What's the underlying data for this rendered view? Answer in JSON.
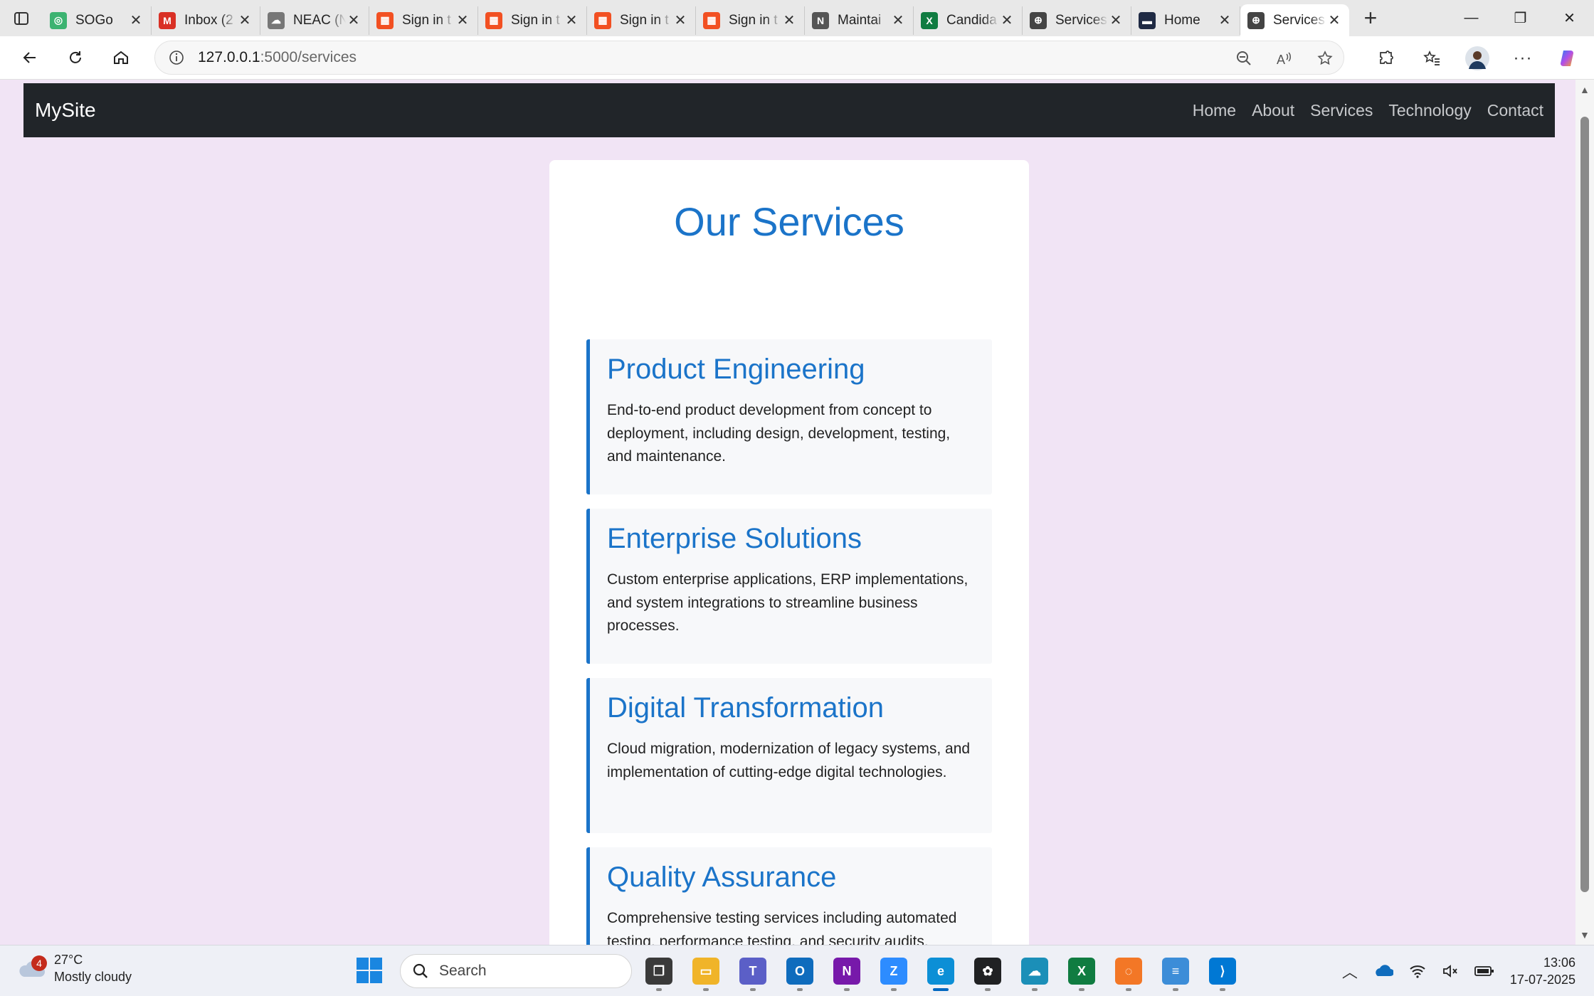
{
  "browser": {
    "tabs": [
      {
        "title": "SOGo",
        "icon": "sogo-icon",
        "color": "#3cb371",
        "glyph": "◎"
      },
      {
        "title": "Inbox (2",
        "icon": "gmail-icon",
        "color": "#d93025",
        "glyph": "M"
      },
      {
        "title": "NEAC (N",
        "icon": "neac-icon",
        "color": "#777777",
        "glyph": "☁"
      },
      {
        "title": "Sign in t",
        "icon": "microsoft-icon",
        "color": "#f25022",
        "glyph": "▦"
      },
      {
        "title": "Sign in t",
        "icon": "microsoft-icon",
        "color": "#f25022",
        "glyph": "▦"
      },
      {
        "title": "Sign in t",
        "icon": "microsoft-icon",
        "color": "#f25022",
        "glyph": "▦"
      },
      {
        "title": "Sign in t",
        "icon": "microsoft-icon",
        "color": "#f25022",
        "glyph": "▦"
      },
      {
        "title": "Maintai",
        "icon": "notion-icon",
        "color": "#555555",
        "glyph": "N"
      },
      {
        "title": "Candida",
        "icon": "excel-icon",
        "color": "#107c41",
        "glyph": "X"
      },
      {
        "title": "Services",
        "icon": "globe-icon",
        "color": "#444444",
        "glyph": "⊕"
      },
      {
        "title": "Home",
        "icon": "terminal-icon",
        "color": "#1f2a44",
        "glyph": "▬"
      },
      {
        "title": "Services",
        "icon": "globe-icon",
        "color": "#444444",
        "glyph": "⊕",
        "active": true
      }
    ],
    "address": {
      "host": "127.0.0.1",
      "path": ":5000/services"
    }
  },
  "site": {
    "brand": "MySite",
    "nav": [
      "Home",
      "About",
      "Services",
      "Technology",
      "Contact"
    ],
    "heading": "Our Services",
    "services": [
      {
        "title": "Product Engineering",
        "description": "End-to-end product development from concept to deployment, including design, development, testing, and maintenance."
      },
      {
        "title": "Enterprise Solutions",
        "description": "Custom enterprise applications, ERP implementations, and system integrations to streamline business processes."
      },
      {
        "title": "Digital Transformation",
        "description": "Cloud migration, modernization of legacy systems, and implementation of cutting-edge digital technologies."
      },
      {
        "title": "Quality Assurance",
        "description": "Comprehensive testing services including automated testing, performance testing, and security audits."
      }
    ],
    "colors": {
      "accent": "#1b74c9",
      "page_bg": "#f1e4f5",
      "navbar": "#212529"
    }
  },
  "taskbar": {
    "weather": {
      "temp": "27°C",
      "condition": "Mostly cloudy",
      "badge": "4"
    },
    "search_placeholder": "Search",
    "apps": [
      {
        "name": "task-view",
        "color": "#3a3a3a",
        "glyph": "❐"
      },
      {
        "name": "file-explorer",
        "color": "#f0b429",
        "glyph": "▭"
      },
      {
        "name": "teams",
        "color": "#5b5fc7",
        "glyph": "T"
      },
      {
        "name": "outlook",
        "color": "#0f6cbd",
        "glyph": "O"
      },
      {
        "name": "onenote",
        "color": "#7719aa",
        "glyph": "N"
      },
      {
        "name": "zoom",
        "color": "#2d8cff",
        "glyph": "Z"
      },
      {
        "name": "edge",
        "color": "#0c8fd6",
        "glyph": "e",
        "active": true
      },
      {
        "name": "chatgpt",
        "color": "#202123",
        "glyph": "✿"
      },
      {
        "name": "onedrive-app",
        "color": "#1b8fb8",
        "glyph": "☁"
      },
      {
        "name": "excel",
        "color": "#107c41",
        "glyph": "X"
      },
      {
        "name": "jupyter",
        "color": "#f37726",
        "glyph": "◌"
      },
      {
        "name": "notepad",
        "color": "#3c8dd8",
        "glyph": "≡"
      },
      {
        "name": "vscode",
        "color": "#0078d4",
        "glyph": "⟩"
      }
    ],
    "time": "13:06",
    "date": "17-07-2025"
  }
}
